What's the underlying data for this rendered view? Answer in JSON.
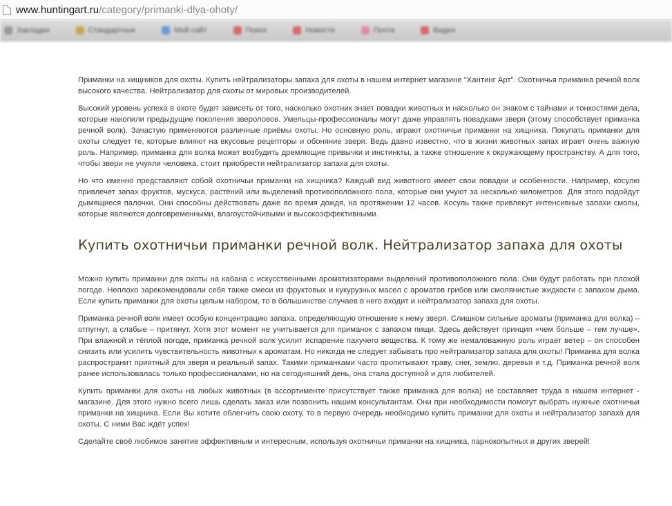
{
  "browser": {
    "url_domain": "www.huntingart.ru",
    "url_path": "/category/primanki-dlya-ohoty/"
  },
  "bookmarks": [
    {
      "label": "Закладки",
      "color": "#9a9a9a"
    },
    {
      "label": "Стандартные",
      "color": "#c9a84a"
    },
    {
      "label": "Мой сайт",
      "color": "#6b9ad8"
    },
    {
      "label": "Поиск",
      "color": "#d86a6a"
    },
    {
      "label": "Новости",
      "color": "#d86a6a"
    },
    {
      "label": "Почта",
      "color": "#e08aa8"
    },
    {
      "label": "Видео",
      "color": "#d86a6a"
    }
  ],
  "article": {
    "paragraphs_top": [
      "Приманки на хищников для охоты. Купить нейтрализаторы запаха для охоты в нашем интернет магазине \"Хантинг Арт\". Охотничья приманка речной волк высокого качества. Нейтрализатор для охоты от мировых производителей.",
      "Высокий уровень успеха в охоте будет зависеть от того, насколько охотник знает повадки животных и насколько он знаком с тайнами и тонкостями дела, которые накопили предыдущие поколения звероловов. Умельцы-профессионалы могут даже управлять повадками зверя (этому способствует приманка речной волк). Зачастую  применяются различные приёмы охоты. Но основную роль, играют охотничьи приманки на хищника. Покупать приманки для охоты следует те, которые влияют на вкусовые рецепторы и обоняние зверя. Ведь давно известно, что в жизни животных запах играет очень важную роль. Например, приманка для волка может возбудить дремлющие привычки и инстинкты, а также отношение к окружающему пространству. А для того, чтобы звери не учуяли человека, стоит приобрести нейтрализатор запаха для охоты.",
      "Но что именно  представляют собой охотничьи приманки на хищника? Каждый вид животного имеет свои повадки и особенности. Например, косулю привлечет запах фруктов, мускуса, растений или выделений противоположного пола, которые они учуют за несколько километров. Для этого подойдут дымящиеся палочки. Они способны действовать даже во время дождя, на протяжении 12 часов. Косуль также привлекут интенсивные запахи смолы, которые являются долговременными, влагоустойчивыми и высокоэффективными."
    ],
    "heading": "Купить охотничьи приманки речной волк. Нейтрализатор запаха для охоты",
    "paragraphs_bottom": [
      "Можно купить приманки для охоты на кабана с искусственными ароматизаторами выделений противоположного пола. Они будут работать при плохой погоде. Неплохо зарекомендовали себя также смеси из фруктовых и кукурузных масел с ароматов грибов или смолянистые жидкости с запахом дыма. Если купить приманки для охоты целым набором, то в большинстве случаев в него входит и нейтрализатор запаха для охоты.",
      "Приманка речной волк имеет особую концентрацию запаха, определяющую отношение к нему зверя. Слишком сильные ароматы (приманка для волка) – отпугнут, а слабые – притянут. Хотя этот момент не учитывается для приманок с запахом пищи. Здесь действует принцип «чем больше – тем лучше». При влажной и тёплой погоде, приманка речной волк усилит испарение пахучего вещества. К тому же немаловажную роль играет ветер – он способен снизить или усилить чувствительность животных к ароматам. Но никогда не следует забывать про нейтрализатор запаха для охоты! Приманка для волка распространит приятный для зверя и реальный запах. Такими  приманками часто пропитывают траву, снег, землю, деревья и т.д. Приманка речной волк ранее использовалась только профессионалами, но на сегодняшний день, она стала доступной и для любителей.",
      "Купить приманки для охоты на любых животных (в ассортименте присутствует  также приманка для волка) не составляет труда в нашем интернет - магазине. Для этого нужно всего лишь сделать заказ или позвонить нашим консультантам. Они при необходимости помогут выбрать нужные охотничьи приманки на хищника. Если Вы хотите облегчить свою охоту, то в первую очередь необходимо купить приманки для охоты и нейтрализатор запаха для охоты. С ними Вас ждёт успех!",
      "Сделайте своё любимое занятие эффективным и интересным, используя охотничьи приманки на хищника, парнокопытных и других зверей!"
    ]
  }
}
